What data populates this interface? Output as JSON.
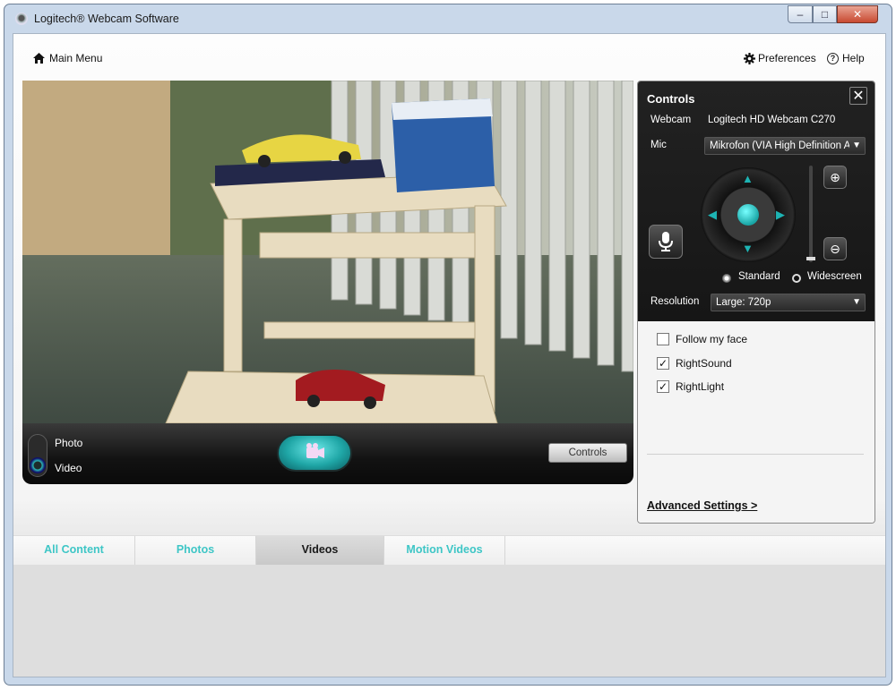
{
  "window": {
    "title": "Logitech® Webcam Software",
    "minimize_label": "–",
    "maximize_label": "□",
    "close_label": "✕"
  },
  "toolbar": {
    "main_menu_label": "Main Menu",
    "preferences_label": "Preferences",
    "help_label": "Help"
  },
  "capture_bar": {
    "photo_label": "Photo",
    "video_label": "Video",
    "selected_mode": "Video",
    "controls_button_label": "Controls"
  },
  "controls_panel": {
    "title": "Controls",
    "close_label": "✕",
    "webcam_label": "Webcam",
    "webcam_value": "Logitech HD Webcam C270",
    "mic_label": "Mic",
    "mic_value": "Mikrofon (VIA High Definition A",
    "aspect_options": {
      "standard_label": "Standard",
      "widescreen_label": "Widescreen",
      "selected": "Widescreen"
    },
    "resolution_label": "Resolution",
    "resolution_value": "Large: 720p",
    "options": [
      {
        "label": "Follow my face",
        "checked": false
      },
      {
        "label": "RightSound",
        "checked": true
      },
      {
        "label": "RightLight",
        "checked": true
      }
    ],
    "advanced_settings_label": "Advanced Settings >"
  },
  "tabs": [
    {
      "label": "All Content",
      "active": false
    },
    {
      "label": "Photos",
      "active": false
    },
    {
      "label": "Videos",
      "active": true
    },
    {
      "label": "Motion Videos",
      "active": false
    }
  ],
  "colors": {
    "accent": "#3ec6c6",
    "dark_panel": "#1b1b1b",
    "window_frame": "#c9d8ea"
  },
  "icons": {
    "home": "home-icon",
    "preferences": "gear-icon",
    "help": "help-icon",
    "record": "video-camera-icon",
    "mic": "microphone-icon",
    "zoom_in": "zoom-in-icon",
    "zoom_out": "zoom-out-icon"
  }
}
